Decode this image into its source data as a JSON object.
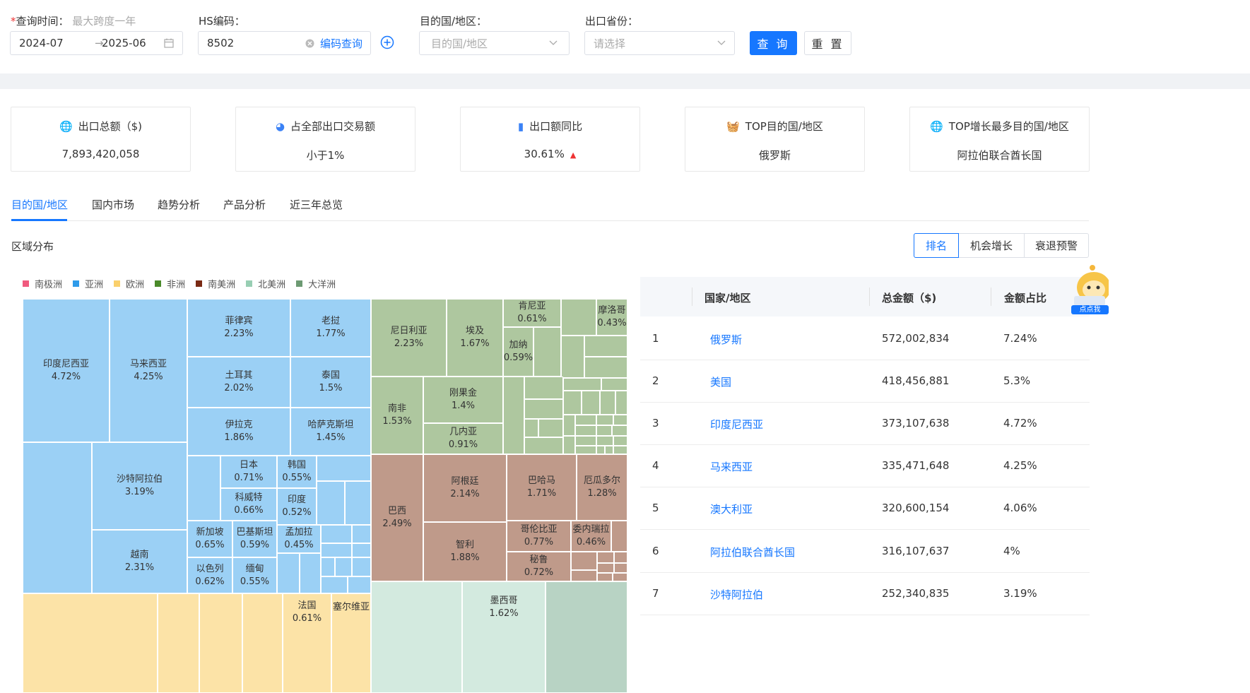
{
  "filters": {
    "date_label": "查询时间：",
    "date_required_mark": "*",
    "date_hint": "最大跨度一年",
    "date_start": "2024-07",
    "date_arrow": "→",
    "date_end": "2025-06",
    "hs_label": "HS编码：",
    "hs_value": "8502",
    "hs_lookup": "编码查询",
    "dest_label": "目的国/地区：",
    "dest_placeholder": "目的国/地区",
    "province_label": "出口省份：",
    "province_placeholder": "请选择",
    "query_btn": "查 询",
    "reset_btn": "重 置"
  },
  "kpis": [
    {
      "title": "出口总额（$)",
      "value": "7,893,420,058",
      "icon": "globe-icon"
    },
    {
      "title": "占全部出口交易额",
      "value": "小于1%",
      "icon": "pie-icon"
    },
    {
      "title": "出口额同比",
      "value": "30.61%",
      "trend": "▲",
      "icon": "bar-chart-icon"
    },
    {
      "title": "TOP目的国/地区",
      "value": "俄罗斯",
      "icon": "basket-icon"
    },
    {
      "title": "TOP增长最多目的国/地区",
      "value": "阿拉伯联合酋长国",
      "icon": "growth-globe-icon"
    }
  ],
  "tabs": [
    "目的国/地区",
    "国内市场",
    "趋势分析",
    "产品分析",
    "近三年总览"
  ],
  "section_title": "区域分布",
  "segments": [
    "排名",
    "机会增长",
    "衰退预警"
  ],
  "legend": [
    {
      "label": "南极洲",
      "color": "#f05a7e"
    },
    {
      "label": "亚洲",
      "color": "#2e9bea"
    },
    {
      "label": "欧洲",
      "color": "#fad06c"
    },
    {
      "label": "非洲",
      "color": "#4a8a2a"
    },
    {
      "label": "南美洲",
      "color": "#7a2a14"
    },
    {
      "label": "北美洲",
      "color": "#98ceb3"
    },
    {
      "label": "大洋洲",
      "color": "#6d9a73"
    }
  ],
  "treemap_labels": {
    "indonesia": {
      "name": "印度尼西亚",
      "pct": "4.72%"
    },
    "malaysia": {
      "name": "马来西亚",
      "pct": "4.25%"
    },
    "philippines": {
      "name": "菲律宾",
      "pct": "2.23%"
    },
    "laos": {
      "name": "老挝",
      "pct": "1.77%"
    },
    "turkey": {
      "name": "土耳其",
      "pct": "2.02%"
    },
    "thailand": {
      "name": "泰国",
      "pct": "1.5%"
    },
    "iraq": {
      "name": "伊拉克",
      "pct": "1.86%"
    },
    "kazakhstan": {
      "name": "哈萨克斯坦",
      "pct": "1.45%"
    },
    "saudi": {
      "name": "沙特阿拉伯",
      "pct": "3.19%"
    },
    "vietnam": {
      "name": "越南",
      "pct": "2.31%"
    },
    "japan": {
      "name": "日本",
      "pct": "0.71%"
    },
    "korea": {
      "name": "韩国",
      "pct": "0.55%"
    },
    "kuwait": {
      "name": "科威特",
      "pct": "0.66%"
    },
    "india": {
      "name": "印度",
      "pct": "0.52%"
    },
    "singapore": {
      "name": "新加坡",
      "pct": "0.65%"
    },
    "pakistan": {
      "name": "巴基斯坦",
      "pct": "0.59%"
    },
    "bangladesh": {
      "name": "孟加拉",
      "pct": "0.45%"
    },
    "israel": {
      "name": "以色列",
      "pct": "0.62%"
    },
    "myanmar": {
      "name": "缅甸",
      "pct": "0.55%"
    },
    "france": {
      "name": "法国",
      "pct": "0.61%"
    },
    "serbia": {
      "name": "塞尔维亚",
      "pct": ""
    },
    "nigeria": {
      "name": "尼日利亚",
      "pct": "2.23%"
    },
    "egypt": {
      "name": "埃及",
      "pct": "1.67%"
    },
    "kenya": {
      "name": "肯尼亚",
      "pct": "0.61%"
    },
    "morocco": {
      "name": "摩洛哥",
      "pct": "0.43%"
    },
    "gabon": {
      "name": "加纳",
      "pct": "0.59%"
    },
    "southafrica": {
      "name": "南非",
      "pct": "1.53%"
    },
    "congo": {
      "name": "刚果金",
      "pct": "1.4%"
    },
    "guinea": {
      "name": "几内亚",
      "pct": "0.91%"
    },
    "brazil": {
      "name": "巴西",
      "pct": "2.49%"
    },
    "argentina": {
      "name": "阿根廷",
      "pct": "2.14%"
    },
    "bahamas": {
      "name": "巴哈马",
      "pct": "1.71%"
    },
    "ecuador": {
      "name": "厄瓜多尔",
      "pct": "1.28%"
    },
    "chile": {
      "name": "智利",
      "pct": "1.88%"
    },
    "colombia": {
      "name": "哥伦比亚",
      "pct": "0.77%"
    },
    "venezuela": {
      "name": "委内瑞拉",
      "pct": "0.46%"
    },
    "peru": {
      "name": "秘鲁",
      "pct": "0.72%"
    },
    "mexico": {
      "name": "墨西哥",
      "pct": "1.62%"
    }
  },
  "table": {
    "headers": [
      "国家/地区",
      "总金额（$)",
      "金额占比"
    ],
    "rows": [
      {
        "rank": "1",
        "country": "俄罗斯",
        "amount": "572,002,834",
        "share": "7.24%"
      },
      {
        "rank": "2",
        "country": "美国",
        "amount": "418,456,881",
        "share": "5.3%"
      },
      {
        "rank": "3",
        "country": "印度尼西亚",
        "amount": "373,107,638",
        "share": "4.72%"
      },
      {
        "rank": "4",
        "country": "马来西亚",
        "amount": "335,471,648",
        "share": "4.25%"
      },
      {
        "rank": "5",
        "country": "澳大利亚",
        "amount": "320,600,154",
        "share": "4.06%"
      },
      {
        "rank": "6",
        "country": "阿拉伯联合酋长国",
        "amount": "316,107,637",
        "share": "4%"
      },
      {
        "rank": "7",
        "country": "沙特阿拉伯",
        "amount": "252,340,835",
        "share": "3.19%"
      }
    ]
  },
  "mascot_label": "点点我"
}
